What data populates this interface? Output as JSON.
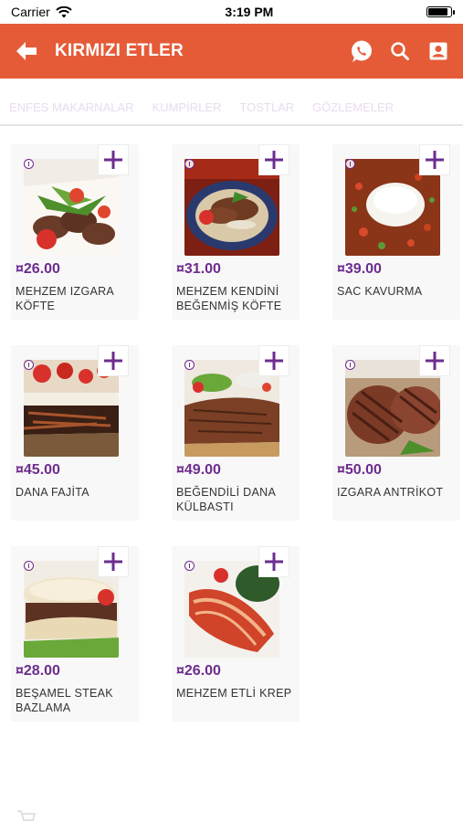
{
  "status": {
    "carrier": "Carrier",
    "time": "3:19 PM",
    "battery_level": 0.9
  },
  "header": {
    "title": "KIRMIZI ETLER",
    "accent": "#e55b37"
  },
  "tabs": [
    "ENFES MAKARNALAR",
    "KUMPİRLER",
    "TOSTLAR",
    "GÖZLEMELER"
  ],
  "price_color": "#6d2c8e",
  "products": [
    {
      "price": "¤26.00",
      "name": "MEHZEM IZGARA KÖFTE"
    },
    {
      "price": "¤31.00",
      "name": "MEHZEM KENDİNİ BEĞENMİŞ KÖFTE"
    },
    {
      "price": "¤39.00",
      "name": "SAC KAVURMA"
    },
    {
      "price": "¤45.00",
      "name": "DANA FAJİTA"
    },
    {
      "price": "¤49.00",
      "name": "BEĞENDİLİ DANA KÜLBASTI"
    },
    {
      "price": "¤50.00",
      "name": "IZGARA ANTRİKOT"
    },
    {
      "price": "¤28.00",
      "name": "BEŞAMEL STEAK BAZLAMA"
    },
    {
      "price": "¤26.00",
      "name": "MEHZEM ETLİ KREP"
    }
  ]
}
